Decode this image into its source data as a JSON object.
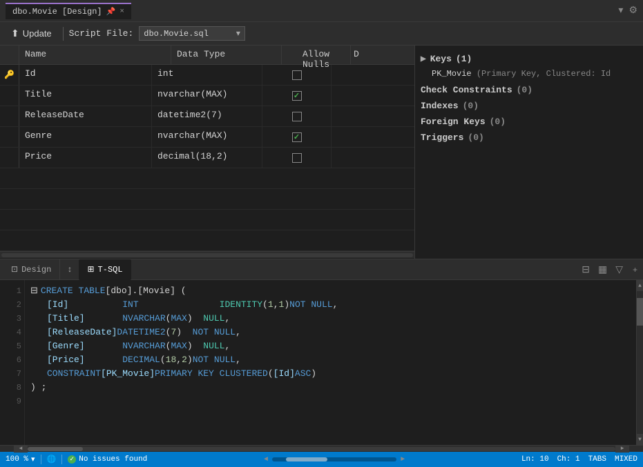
{
  "titleBar": {
    "tabName": "dbo.Movie [Design]",
    "pinIcon": "📌",
    "closeIcon": "×",
    "dropdownIcon": "▾",
    "gearIcon": "⚙"
  },
  "toolbar": {
    "updateLabel": "Update",
    "updateIcon": "⬆",
    "scriptFileLabel": "Script File:",
    "scriptFileValue": "dbo.Movie.sql",
    "dropdownArrow": "▾"
  },
  "designTable": {
    "columns": [
      {
        "label": "Name"
      },
      {
        "label": "Data Type"
      },
      {
        "label": "Allow Nulls"
      },
      {
        "label": "D"
      }
    ],
    "rows": [
      {
        "indicator": "🔑",
        "name": "Id",
        "dataType": "int",
        "allowNulls": false,
        "isKey": true
      },
      {
        "indicator": "",
        "name": "Title",
        "dataType": "nvarchar(MAX)",
        "allowNulls": true,
        "isKey": false
      },
      {
        "indicator": "",
        "name": "ReleaseDate",
        "dataType": "datetime2(7)",
        "allowNulls": false,
        "isKey": false
      },
      {
        "indicator": "",
        "name": "Genre",
        "dataType": "nvarchar(MAX)",
        "allowNulls": true,
        "isKey": false
      },
      {
        "indicator": "",
        "name": "Price",
        "dataType": "decimal(18,2)",
        "allowNulls": false,
        "isKey": false
      }
    ]
  },
  "propertiesPanel": {
    "keysLabel": "Keys",
    "keysCount": "(1)",
    "pkEntry": "PK_Movie",
    "pkDetail": "(Primary Key, Clustered: Id",
    "checkConstraintsLabel": "Check Constraints",
    "checkConstraintsCount": "(0)",
    "indexesLabel": "Indexes",
    "indexesCount": "(0)",
    "foreignKeysLabel": "Foreign Keys",
    "foreignKeysCount": "(0)",
    "triggersLabel": "Triggers",
    "triggersCount": "(0)"
  },
  "tabs": {
    "designLabel": "Design",
    "sortIcon": "↕",
    "tsqlLabel": "T-SQL",
    "tsqlIcon": "⊞"
  },
  "codeLines": [
    {
      "num": 1,
      "indent": "collapse",
      "content": [
        {
          "t": "CREATE TABLE ",
          "c": "kw-keyword"
        },
        {
          "t": "[dbo]",
          "c": "kw-white"
        },
        {
          "t": ".",
          "c": "kw-white"
        },
        {
          "t": "[Movie]",
          "c": "kw-white"
        },
        {
          "t": " (",
          "c": "kw-white"
        }
      ]
    },
    {
      "num": 2,
      "indent": "    ",
      "content": [
        {
          "t": "[Id]",
          "c": "kw-cyan"
        },
        {
          "t": "          ",
          "c": "kw-white"
        },
        {
          "t": "INT",
          "c": "kw-keyword"
        },
        {
          "t": "               ",
          "c": "kw-white"
        },
        {
          "t": "IDENTITY",
          "c": "kw-green"
        },
        {
          "t": " (",
          "c": "kw-white"
        },
        {
          "t": "1",
          "c": "kw-num"
        },
        {
          "t": ", ",
          "c": "kw-white"
        },
        {
          "t": "1",
          "c": "kw-num"
        },
        {
          "t": ") ",
          "c": "kw-white"
        },
        {
          "t": "NOT NULL",
          "c": "kw-keyword"
        },
        {
          "t": ",",
          "c": "kw-white"
        }
      ]
    },
    {
      "num": 3,
      "indent": "    ",
      "content": [
        {
          "t": "[Title]",
          "c": "kw-cyan"
        },
        {
          "t": "       ",
          "c": "kw-white"
        },
        {
          "t": "NVARCHAR",
          "c": "kw-keyword"
        },
        {
          "t": " (",
          "c": "kw-white"
        },
        {
          "t": "MAX",
          "c": "kw-keyword"
        },
        {
          "t": ")",
          "c": "kw-white"
        },
        {
          "t": "  NULL",
          "c": "kw-green"
        },
        {
          "t": ",",
          "c": "kw-white"
        }
      ]
    },
    {
      "num": 4,
      "indent": "    ",
      "content": [
        {
          "t": "[ReleaseDate]",
          "c": "kw-cyan"
        },
        {
          "t": " ",
          "c": "kw-white"
        },
        {
          "t": "DATETIME2",
          "c": "kw-keyword"
        },
        {
          "t": " (",
          "c": "kw-white"
        },
        {
          "t": "7",
          "c": "kw-num"
        },
        {
          "t": ")",
          "c": "kw-white"
        },
        {
          "t": "  NOT NULL",
          "c": "kw-keyword"
        },
        {
          "t": ",",
          "c": "kw-white"
        }
      ]
    },
    {
      "num": 5,
      "indent": "    ",
      "content": [
        {
          "t": "[Genre]",
          "c": "kw-cyan"
        },
        {
          "t": "       ",
          "c": "kw-white"
        },
        {
          "t": "NVARCHAR",
          "c": "kw-keyword"
        },
        {
          "t": " (",
          "c": "kw-white"
        },
        {
          "t": "MAX",
          "c": "kw-keyword"
        },
        {
          "t": ")",
          "c": "kw-white"
        },
        {
          "t": "  NULL",
          "c": "kw-green"
        },
        {
          "t": ",",
          "c": "kw-white"
        }
      ]
    },
    {
      "num": 6,
      "indent": "    ",
      "content": [
        {
          "t": "[Price]",
          "c": "kw-cyan"
        },
        {
          "t": "       ",
          "c": "kw-white"
        },
        {
          "t": "DECIMAL",
          "c": "kw-keyword"
        },
        {
          "t": " (",
          "c": "kw-white"
        },
        {
          "t": "18",
          "c": "kw-num"
        },
        {
          "t": ", ",
          "c": "kw-white"
        },
        {
          "t": "2",
          "c": "kw-num"
        },
        {
          "t": ") ",
          "c": "kw-white"
        },
        {
          "t": "NOT NULL",
          "c": "kw-keyword"
        },
        {
          "t": ",",
          "c": "kw-white"
        }
      ]
    },
    {
      "num": 7,
      "indent": "    ",
      "content": [
        {
          "t": "CONSTRAINT",
          "c": "kw-keyword"
        },
        {
          "t": " ",
          "c": "kw-white"
        },
        {
          "t": "[PK_Movie]",
          "c": "kw-cyan"
        },
        {
          "t": " ",
          "c": "kw-white"
        },
        {
          "t": "PRIMARY KEY CLUSTERED",
          "c": "kw-keyword"
        },
        {
          "t": " (",
          "c": "kw-white"
        },
        {
          "t": "[Id]",
          "c": "kw-cyan"
        },
        {
          "t": " ",
          "c": "kw-white"
        },
        {
          "t": "ASC",
          "c": "kw-keyword"
        },
        {
          "t": ")",
          "c": "kw-white"
        }
      ]
    },
    {
      "num": 8,
      "indent": "",
      "content": [
        {
          "t": ") ;",
          "c": "kw-white"
        }
      ]
    },
    {
      "num": 9,
      "indent": "",
      "content": []
    }
  ],
  "statusBar": {
    "zoom": "100 %",
    "zoomIcon": "🔍",
    "globeIcon": "🌐",
    "statusText": "No issues found",
    "arrowLeft": "◄",
    "arrowRight": "►",
    "lineInfo": "Ln: 10",
    "colInfo": "Ch: 1",
    "tabs": "TABS",
    "mixed": "MIXED"
  }
}
